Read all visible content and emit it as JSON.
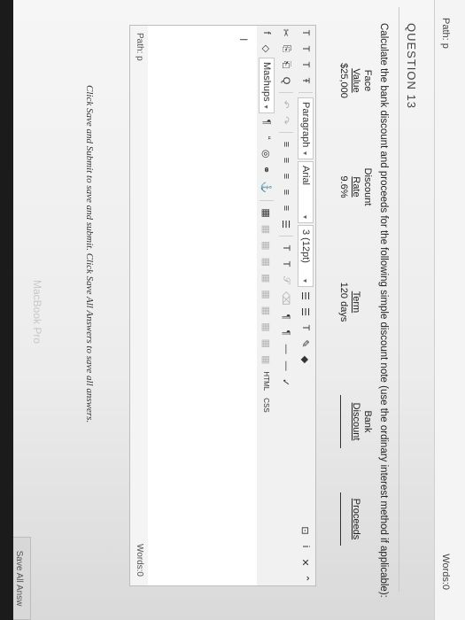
{
  "top_bar": {
    "path": "Path: p",
    "words": "Words:0"
  },
  "question": {
    "title": "QUESTION 13",
    "prompt": "Calculate the bank discount and proceeds for the following simple discount note (use the ordinary interest method if applicable):",
    "table": {
      "headers": [
        {
          "line1": "Face",
          "line2": "Value"
        },
        {
          "line1": "Discount",
          "line2": "Rate"
        },
        {
          "line1": "",
          "line2": "Term"
        },
        {
          "line1": "Bank",
          "line2": "Discount"
        },
        {
          "line1": "",
          "line2": "Proceeds"
        }
      ],
      "values": [
        "$25,000",
        "9.6%",
        "120 days",
        "",
        ""
      ]
    }
  },
  "toolbar": {
    "row1": [
      "T",
      "T",
      "T",
      "Ŧ"
    ],
    "paragraph": "Paragraph",
    "font": "Arial",
    "size": "3 (12pt)",
    "row1_right": [
      "☰",
      "☰",
      "T",
      "✎",
      "◆"
    ],
    "row1_icons": [
      "⊡",
      "i",
      "✕",
      "⌃"
    ],
    "row2": [
      "✂",
      "⎘",
      "⎗",
      "Q",
      "↶",
      "↷",
      "≡",
      "≡",
      "≡",
      "≡",
      "≡",
      "☰",
      "T",
      "T",
      "𝒮",
      "⌫",
      "¶",
      "¶",
      "—",
      "—",
      "✓"
    ],
    "row3": [
      "f",
      "◇",
      "Mashups",
      "¶",
      "“",
      "◎",
      "⚭",
      "⚓",
      "▦",
      "▦",
      "▦",
      "▦",
      "▦",
      "▦",
      "▦",
      "▦",
      "▦",
      "▦",
      "HTML",
      "CSS"
    ]
  },
  "editor": {
    "cursor": "I"
  },
  "bottom_bar": {
    "path": "Path: p",
    "words": "Words:0"
  },
  "footer": {
    "note": "Click Save and Submit to save and submit. Click Save All Answers to save all answers.",
    "save_all": "Save All Answ"
  },
  "device": {
    "brand": "MacBook Pro"
  }
}
